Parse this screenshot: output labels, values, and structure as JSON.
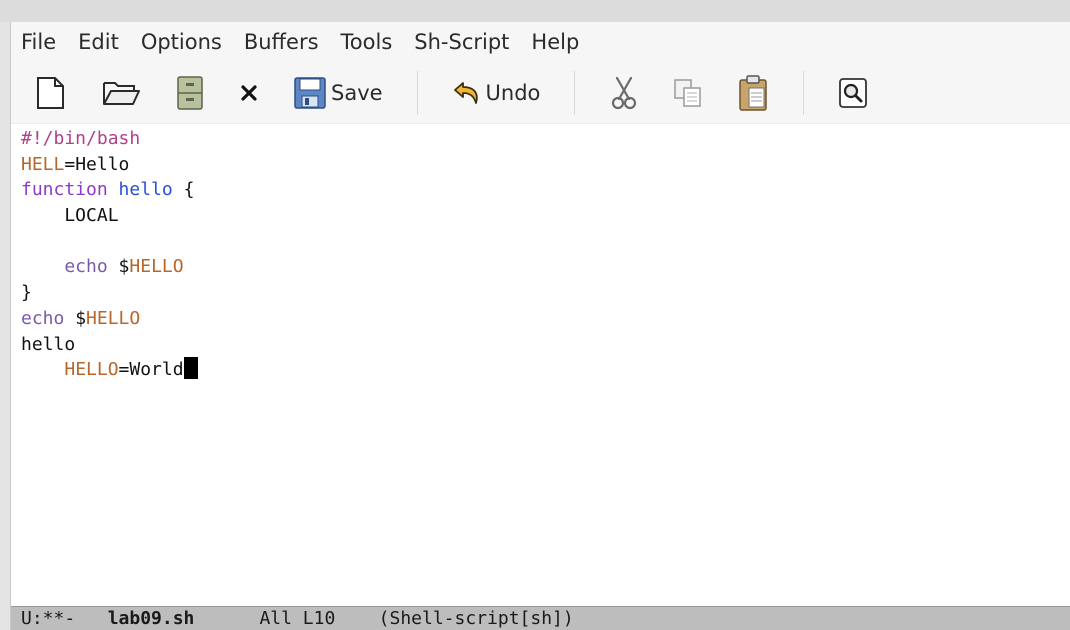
{
  "menu": [
    "File",
    "Edit",
    "Options",
    "Buffers",
    "Tools",
    "Sh-Script",
    "Help"
  ],
  "toolbar": {
    "save_label": "Save",
    "undo_label": "Undo"
  },
  "editor": {
    "lines": [
      [
        {
          "t": "#!/bin/bash",
          "c": "#b0408a"
        }
      ],
      [
        {
          "t": "HELL",
          "c": "#b8662a"
        },
        {
          "t": "=Hello",
          "c": "#111111"
        }
      ],
      [
        {
          "t": "function",
          "c": "#8a3cc8"
        },
        {
          "t": " ",
          "c": "#111111"
        },
        {
          "t": "hello",
          "c": "#2a4fd4"
        },
        {
          "t": " {",
          "c": "#111111"
        }
      ],
      [
        {
          "t": "    LOCAL",
          "c": "#111111"
        }
      ],
      [],
      [
        {
          "t": "    echo",
          "c": "#7a5aa8"
        },
        {
          "t": " $",
          "c": "#111111"
        },
        {
          "t": "HELLO",
          "c": "#b8662a"
        }
      ],
      [
        {
          "t": "}",
          "c": "#111111"
        }
      ],
      [
        {
          "t": "echo",
          "c": "#7a5aa8"
        },
        {
          "t": " $",
          "c": "#111111"
        },
        {
          "t": "HELLO",
          "c": "#b8662a"
        }
      ],
      [
        {
          "t": "hello",
          "c": "#111111"
        }
      ],
      [
        {
          "t": "    ",
          "c": "#111111"
        },
        {
          "t": "HELLO",
          "c": "#b8662a"
        },
        {
          "t": "=World",
          "c": "#111111"
        }
      ]
    ],
    "cursor_line": 9
  },
  "modeline": {
    "status": "U:**-",
    "buffer": "lab09.sh",
    "position": "All L10",
    "mode": "(Shell-script[sh])"
  }
}
